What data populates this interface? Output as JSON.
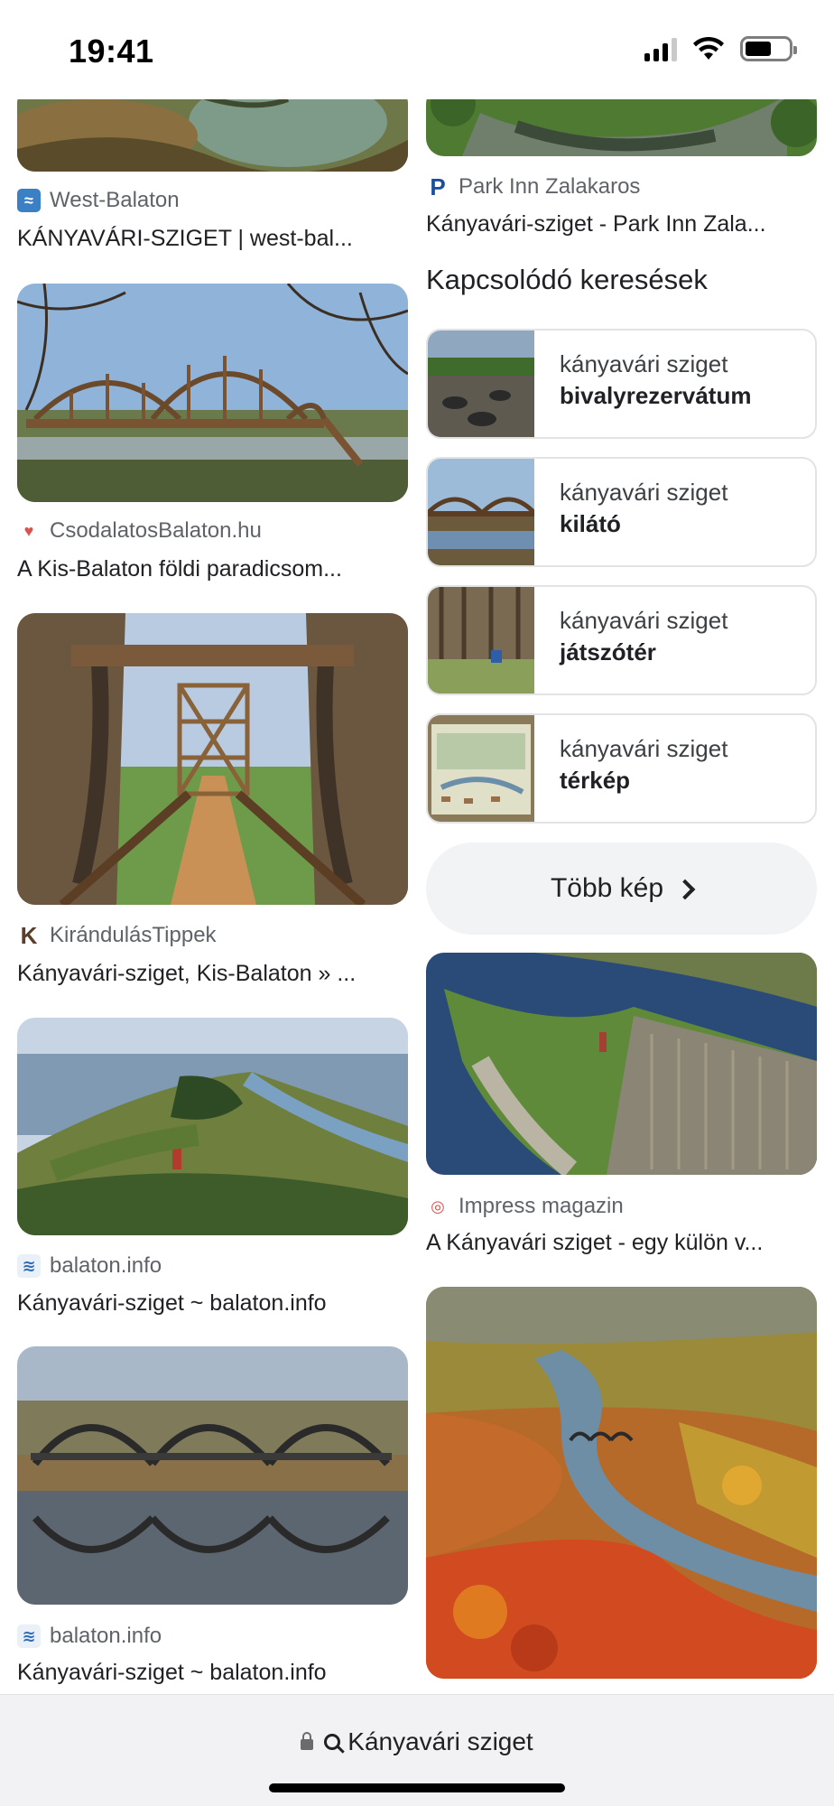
{
  "status_bar": {
    "time": "19:41",
    "icons": [
      "signal-icon",
      "wifi-icon",
      "battery-icon"
    ]
  },
  "left_column": [
    {
      "source": "West-Balaton",
      "caption": "KÁNYAVÁRI-SZIGET | west-bal...",
      "icon": "west-balaton-logo-icon"
    },
    {
      "source": "CsodalatosBalaton.hu",
      "caption": "A Kis-Balaton földi paradicsom...",
      "icon": "csodalatos-balaton-logo-icon"
    },
    {
      "source": "KirándulásTippek",
      "caption": "Kányavári-sziget, Kis-Balaton » ...",
      "icon": "kirandulastippek-logo-icon"
    },
    {
      "source": "balaton.info",
      "caption": "Kányavári-sziget ~ balaton.info",
      "icon": "balaton-info-logo-icon"
    },
    {
      "source": "balaton.info",
      "caption": "Kányavári-sziget ~ balaton.info",
      "icon": "balaton-info-logo-icon"
    }
  ],
  "right_column": {
    "top_result": {
      "source": "Park Inn Zalakaros",
      "caption": "Kányavári-sziget - Park Inn Zala...",
      "icon": "park-inn-logo-icon"
    },
    "related_title": "Kapcsolódó keresések",
    "related": [
      {
        "line1": "kányavári sziget",
        "line2": "bivalyrezervátum"
      },
      {
        "line1": "kányavári sziget",
        "line2": "kilátó"
      },
      {
        "line1": "kányavári sziget",
        "line2": "játszótér"
      },
      {
        "line1": "kányavári sziget",
        "line2": "térkép"
      }
    ],
    "more_button": "Több kép",
    "result2": {
      "source": "Impress magazin",
      "caption": "A Kányavári sziget - egy külön v...",
      "icon": "impress-magazin-logo-icon"
    }
  },
  "url_bar": {
    "text": "Kányavári sziget"
  },
  "colors": {
    "accent_text": "#202124",
    "secondary_text": "#5f6368",
    "card_border": "#e3e3e3",
    "button_bg": "#f1f3f4"
  }
}
